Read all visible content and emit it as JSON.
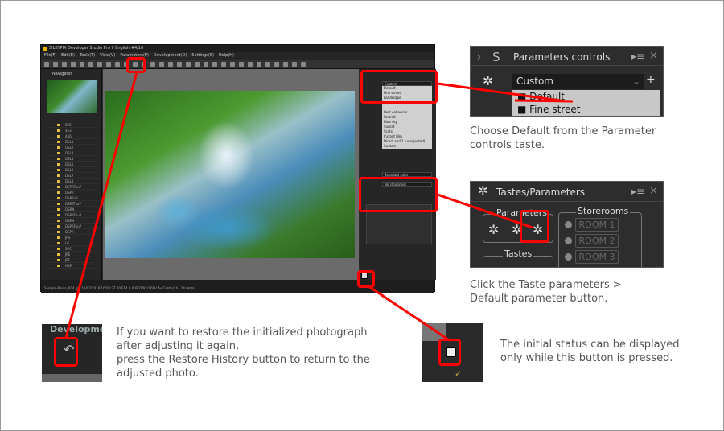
{
  "app": {
    "title": "SILKYPIX Developer Studio Pro 9 English   #4/16",
    "menu": [
      "File(F)",
      "Edit(E)",
      "Tools(T)",
      "View(V)",
      "Parameters(P)",
      "Development(D)",
      "Settings(S)",
      "Help(H)"
    ],
    "navigator_label": "Navigator",
    "folders": [
      "IMG",
      "453",
      "456",
      "DSL1",
      "DSL2",
      "DSL3",
      "DSL4",
      "DSL5",
      "DSL6",
      "DSL7",
      "DSL8",
      "DSPRFsuP",
      "DSPR",
      "DSPRuP",
      "DSRTFsuP",
      "DSRN",
      "DSPRFsuP",
      "DSRN",
      "DSPRFsuP",
      "DSPR",
      "JPS",
      "LG",
      "SPC",
      "JPE",
      "JPF",
      "HDR"
    ],
    "param_dropdown": "Custom",
    "taste_list": [
      "Default",
      "Fine street",
      "Landscape",
      "Best enhances",
      "Portrait",
      "Blue sky",
      "Sunset",
      "Scots",
      "Instant film",
      "Direct and 1 (unadjusted)",
      "Custom"
    ],
    "color_dropdown": "Standard color",
    "sharp_dropdown": "No sharpness",
    "status": "Sample-Photo_004.jpg 12/07/2018 16:03:27.00 F14 0,4 ISO100 0.0EV Av(Center) f= 24.0mm"
  },
  "callout1": {
    "panel_title": "Parameters controls",
    "dropdown": "Custom",
    "items": [
      "Default",
      "Fine street"
    ],
    "note": [
      "Choose Default from the Parameter",
      "controls taste."
    ]
  },
  "callout2": {
    "panel_title": "Tastes/Parameters",
    "parameters_label": "Parameters",
    "storerooms_label": "Storerooms",
    "tastes_label": "Tastes",
    "rooms": [
      "ROOM 1",
      "ROOM 2",
      "ROOM 3"
    ],
    "note": [
      "Click the Taste parameters >",
      "Default parameter button."
    ]
  },
  "callout3": {
    "menu_label": "Developme",
    "note": [
      "If you want to restore the initialized photograph",
      "after adjusting it again,",
      "press the Restore History button to return to the",
      "adjusted photo."
    ]
  },
  "callout4": {
    "note": [
      "The initial status can be displayed",
      "only while this button is pressed."
    ]
  },
  "accent": "#ff0000"
}
